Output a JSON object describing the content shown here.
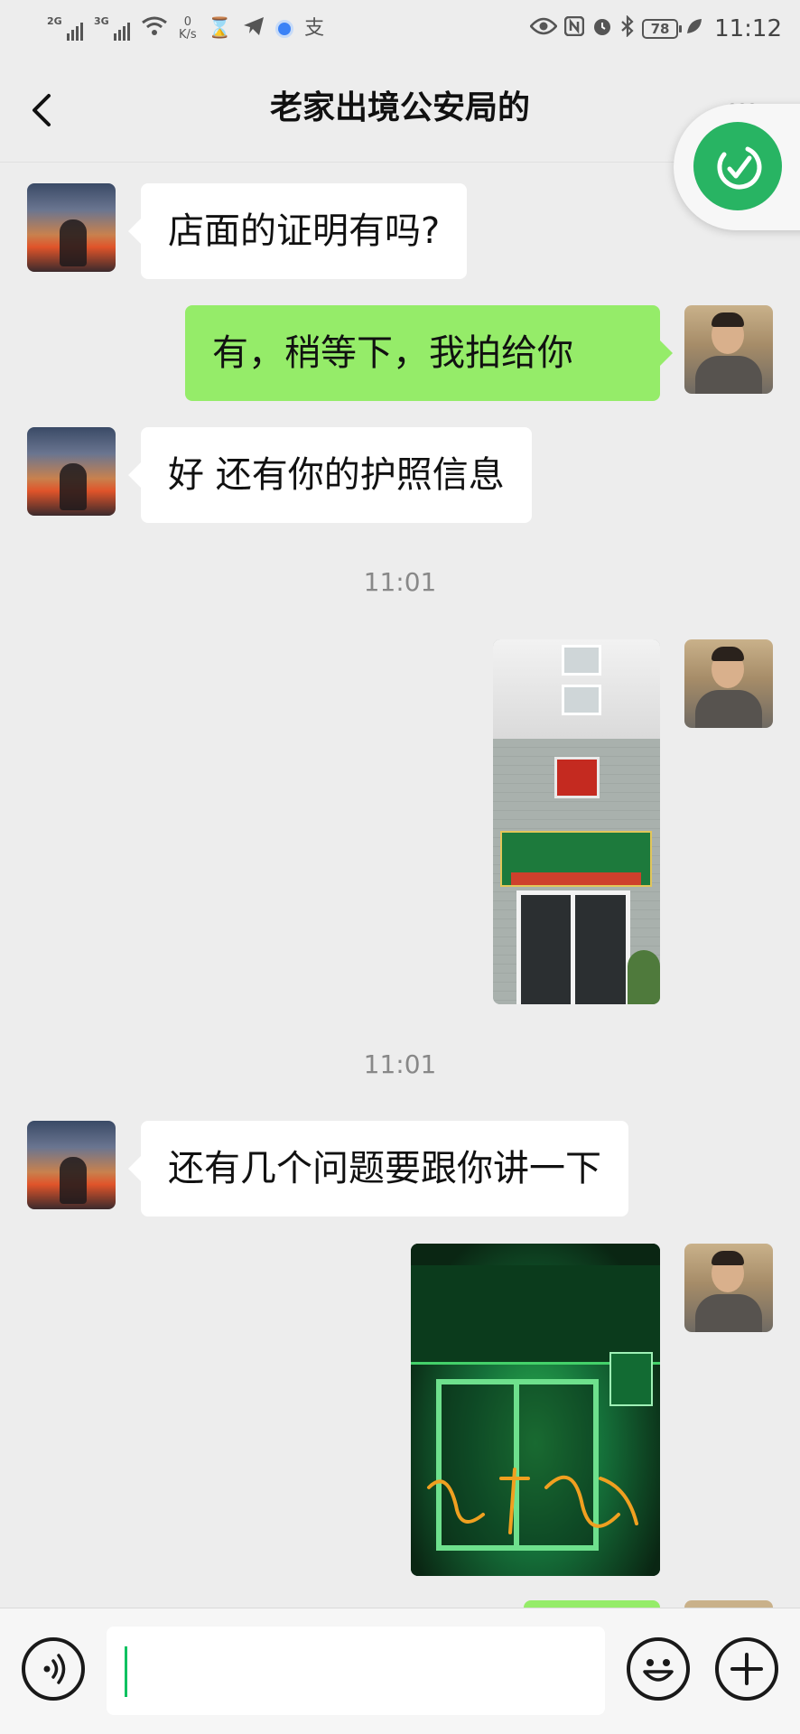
{
  "status_bar": {
    "signal_1": "2G",
    "signal_2": "3G",
    "speed_value": "0",
    "speed_unit": "K/s",
    "alipay": "支",
    "battery": "78",
    "time": "11:12"
  },
  "nav": {
    "title": "老家出境公安局的"
  },
  "messages": [
    {
      "side": "in",
      "text": "店面的证明有吗?"
    },
    {
      "side": "out",
      "text": "有，稍等下，我拍给你"
    },
    {
      "side": "in",
      "text": "好 还有你的护照信息"
    },
    {
      "timestamp": "11:01"
    },
    {
      "side": "out",
      "type": "image"
    },
    {
      "timestamp": "11:01"
    },
    {
      "side": "in",
      "text": "还有几个问题要跟你讲一下"
    },
    {
      "side": "out",
      "type": "image"
    }
  ],
  "colors": {
    "background": "#ededed",
    "bubble_out": "#95ec69",
    "bubble_in": "#ffffff",
    "accent": "#07c160"
  },
  "icons": [
    "back-arrow-icon",
    "more-icon",
    "voice-icon",
    "emoji-icon",
    "plus-icon"
  ]
}
